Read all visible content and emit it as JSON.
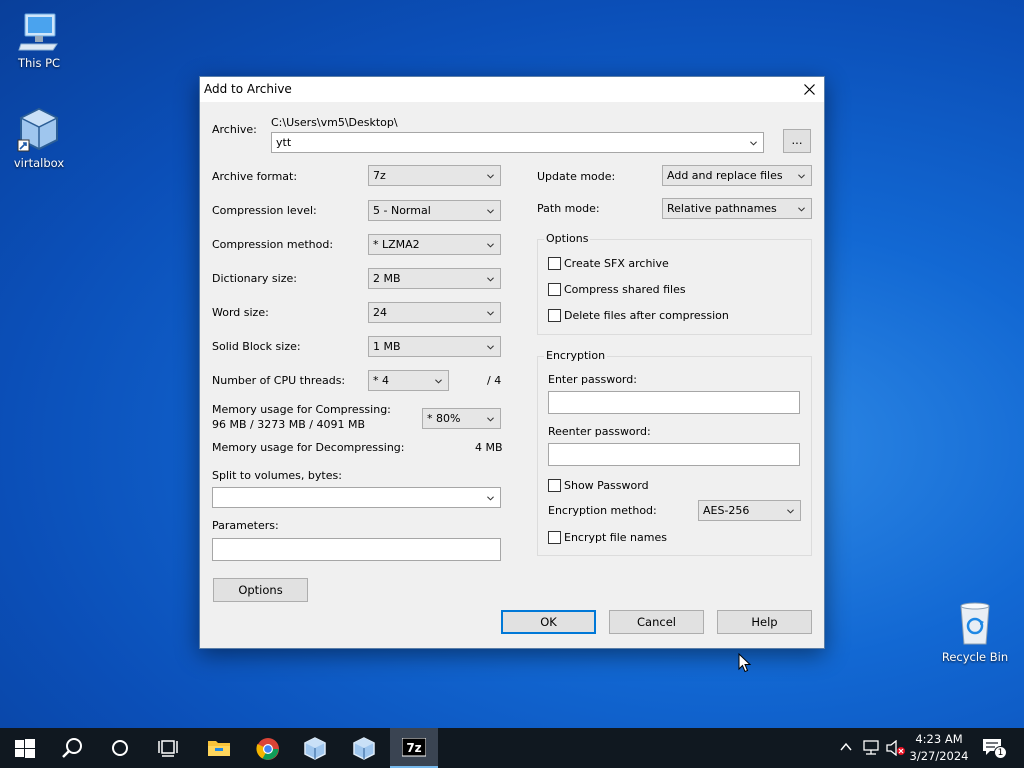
{
  "desktop": {
    "icons": [
      {
        "label": "This PC"
      },
      {
        "label": "virtalbox"
      },
      {
        "label": "Recycle Bin"
      }
    ]
  },
  "dialog": {
    "title": "Add to Archive",
    "archive_label": "Archive:",
    "archive_path": "C:\\Users\\vm5\\Desktop\\",
    "archive_name": "ytt",
    "browse_label": "...",
    "left": {
      "archive_format": {
        "label": "Archive format:",
        "value": "7z"
      },
      "compression_level": {
        "label": "Compression level:",
        "value": "5 - Normal"
      },
      "compression_method": {
        "label": "Compression method:",
        "value": "*  LZMA2"
      },
      "dictionary_size": {
        "label": "Dictionary size:",
        "value": "2 MB"
      },
      "word_size": {
        "label": "Word size:",
        "value": "24"
      },
      "solid_block_size": {
        "label": "Solid Block size:",
        "value": "1 MB"
      },
      "cpu_threads": {
        "label": "Number of CPU threads:",
        "value": "*  4",
        "total": "/ 4"
      },
      "memory_compress": {
        "label": "Memory usage for Compressing:",
        "detail": "96 MB / 3273 MB / 4091 MB",
        "value": "*  80%"
      },
      "memory_decompress": {
        "label": "Memory usage for Decompressing:",
        "value": "4 MB"
      },
      "split_label": "Split to volumes, bytes:",
      "split_value": "",
      "parameters_label": "Parameters:",
      "parameters_value": "",
      "options_button": "Options"
    },
    "right": {
      "update_mode": {
        "label": "Update mode:",
        "value": "Add and replace files"
      },
      "path_mode": {
        "label": "Path mode:",
        "value": "Relative pathnames"
      },
      "options_group": "Options",
      "options": [
        {
          "label": "Create SFX archive",
          "checked": false
        },
        {
          "label": "Compress shared files",
          "checked": false
        },
        {
          "label": "Delete files after compression",
          "checked": false
        }
      ],
      "encryption_group": "Encryption",
      "enter_password_label": "Enter password:",
      "reenter_password_label": "Reenter password:",
      "show_password_label": "Show Password",
      "encryption_method": {
        "label": "Encryption method:",
        "value": "AES-256"
      },
      "encrypt_names_label": "Encrypt file names"
    },
    "buttons": {
      "ok": "OK",
      "cancel": "Cancel",
      "help": "Help"
    }
  },
  "taskbar": {
    "time": "4:23 AM",
    "date": "3/27/2024",
    "notification_count": "1"
  },
  "colors": {
    "desktop_blue": "#1268d3",
    "taskbar": "#101820",
    "dialog_bg": "#f0f0f0",
    "focus_blue": "#0078d7"
  }
}
